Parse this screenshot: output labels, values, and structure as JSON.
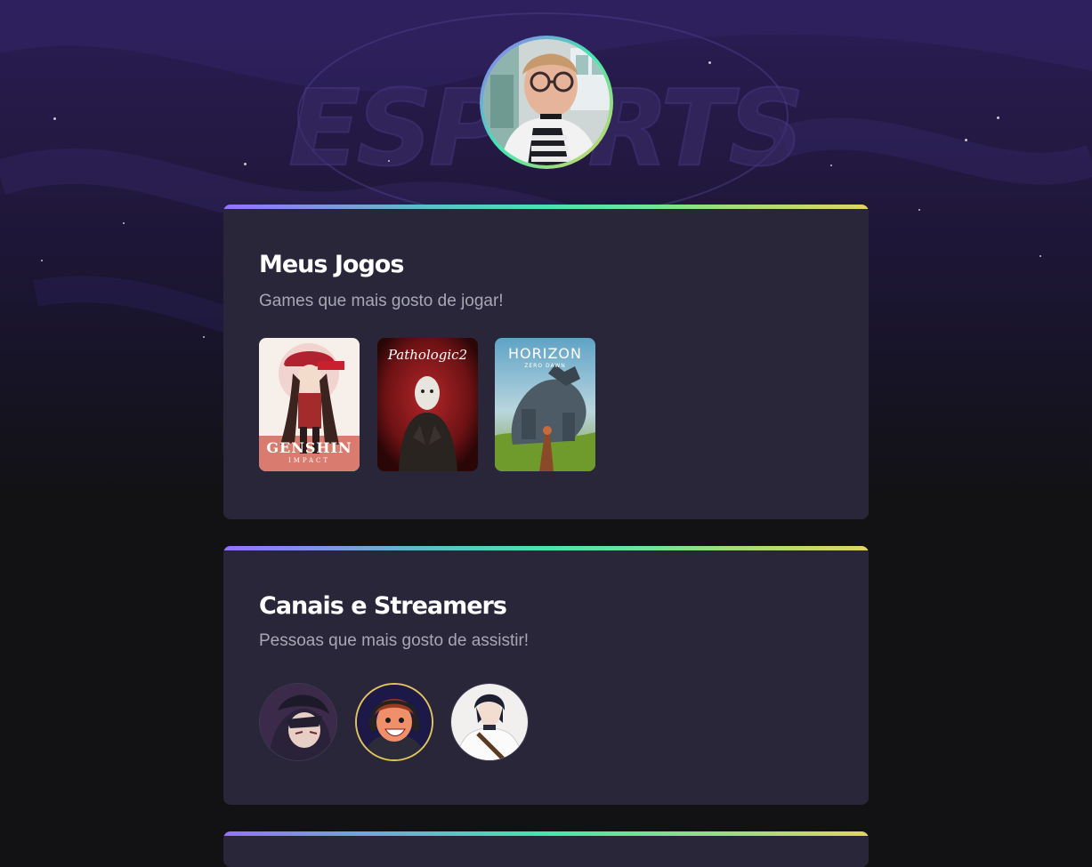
{
  "background": {
    "watermark": "ESPORTS",
    "colors": {
      "top": "#2a1d55",
      "bottom": "#121214"
    }
  },
  "profile": {
    "avatar": "profile-photo"
  },
  "sections": [
    {
      "title": "Meus Jogos",
      "subtitle": "Games que mais gosto de jogar!",
      "items": [
        {
          "name": "genshin-impact-cover",
          "logo": "GENSHIN",
          "tagline": "IMPACT"
        },
        {
          "name": "pathologic-2-cover",
          "logo": "Pathologic2"
        },
        {
          "name": "horizon-zero-dawn-cover",
          "logo": "HORIZON",
          "tagline": "ZERO DAWN"
        }
      ]
    },
    {
      "title": "Canais e Streamers",
      "subtitle": "Pessoas que mais gosto de assistir!",
      "items": [
        {
          "name": "streamer-1-avatar"
        },
        {
          "name": "streamer-2-avatar"
        },
        {
          "name": "streamer-3-avatar"
        }
      ]
    }
  ],
  "accent_gradient": [
    "#9572fc",
    "#43e7ad",
    "#e1d55d"
  ]
}
